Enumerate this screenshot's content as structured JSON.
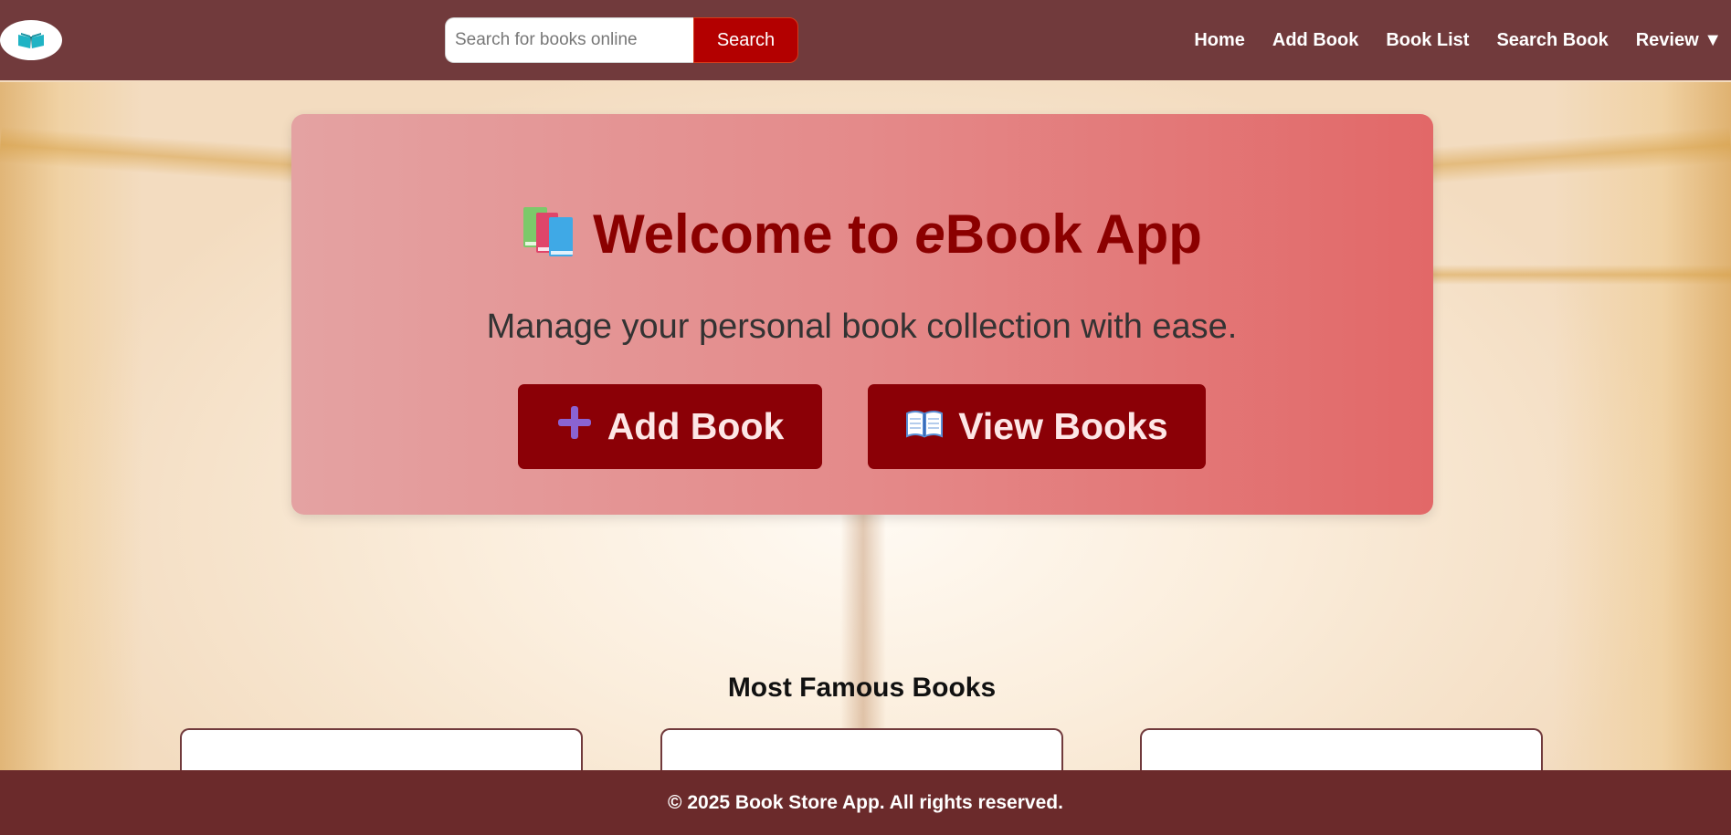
{
  "header": {
    "logo_icon": "open-book-icon",
    "search": {
      "placeholder": "Search for books online",
      "button_label": "Search"
    },
    "nav": [
      {
        "label": "Home"
      },
      {
        "label": "Add Book"
      },
      {
        "label": "Book List"
      },
      {
        "label": "Search Book"
      },
      {
        "label": "Review ▼"
      }
    ]
  },
  "hero": {
    "title_icon": "books-icon",
    "title_prefix": "Welcome to ",
    "title_em": "e",
    "title_rest": "Book App",
    "subtitle": "Manage your personal book collection with ease.",
    "add_button": {
      "icon": "plus-icon",
      "label": "Add Book"
    },
    "view_button": {
      "icon": "open-book-icon",
      "label": "View Books"
    }
  },
  "section": {
    "title": "Most Famous Books"
  },
  "footer": {
    "text": "© 2025 Book Store App. All rights reserved."
  },
  "colors": {
    "header_bg": "#713a3c",
    "footer_bg": "#6b2a2b",
    "accent": "#8b0000",
    "search_button": "#b30000"
  }
}
